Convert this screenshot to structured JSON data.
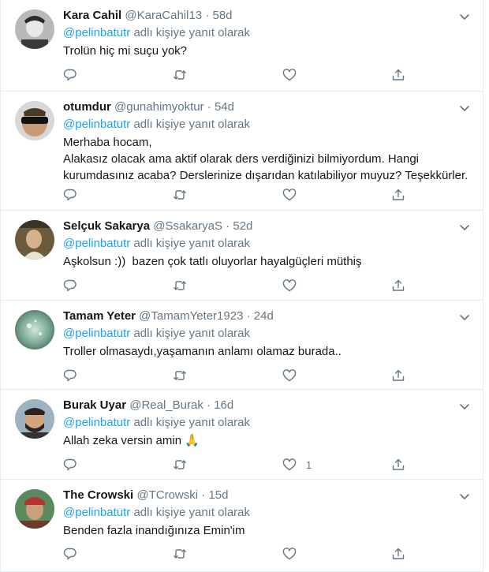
{
  "reply_prefix": "adlı kişiye yanıt olarak",
  "accent_color": "#1da1f2",
  "tweets": [
    {
      "name": "Kara Cahil",
      "handle": "@KaraCahil13",
      "dot": "·",
      "time": "58d",
      "mention": "@pelinbatutr",
      "text": "Trolün hiç mi suçu yok?",
      "like_count": ""
    },
    {
      "name": "otumdur",
      "handle": "@gunahimyoktur",
      "dot": "·",
      "time": "54d",
      "mention": "@pelinbatutr",
      "text": "Merhaba hocam,\nAlakasız olacak ama aktif olarak ders verdiğinizi bilmiyordum. Hangi kurumdasınız acaba? Derslerinize dışarıdan katılabiliyor muyuz? Teşekkürler.",
      "like_count": ""
    },
    {
      "name": "Selçuk Sakarya",
      "handle": "@SsakaryaS",
      "dot": "·",
      "time": "52d",
      "mention": "@pelinbatutr",
      "text": "Aşkolsun :))  bazen çok tatlı oluyorlar hayalgüçleri müthiş",
      "like_count": ""
    },
    {
      "name": "Tamam Yeter",
      "handle": "@TamamYeter1923",
      "dot": "·",
      "time": "24d",
      "mention": "@pelinbatutr",
      "text": "Troller olmasaydı,yaşamanın anlamı olamaz burada..",
      "like_count": ""
    },
    {
      "name": "Burak Uyar",
      "handle": "@Real_Burak",
      "dot": "·",
      "time": "16d",
      "mention": "@pelinbatutr",
      "text": "Allah zeka versin amin 🙏",
      "like_count": "1"
    },
    {
      "name": "The Crowski",
      "handle": "@TCrowski",
      "dot": "·",
      "time": "15d",
      "mention": "@pelinbatutr",
      "text": "Benden fazla inandığınıza Emin'im",
      "like_count": ""
    }
  ]
}
